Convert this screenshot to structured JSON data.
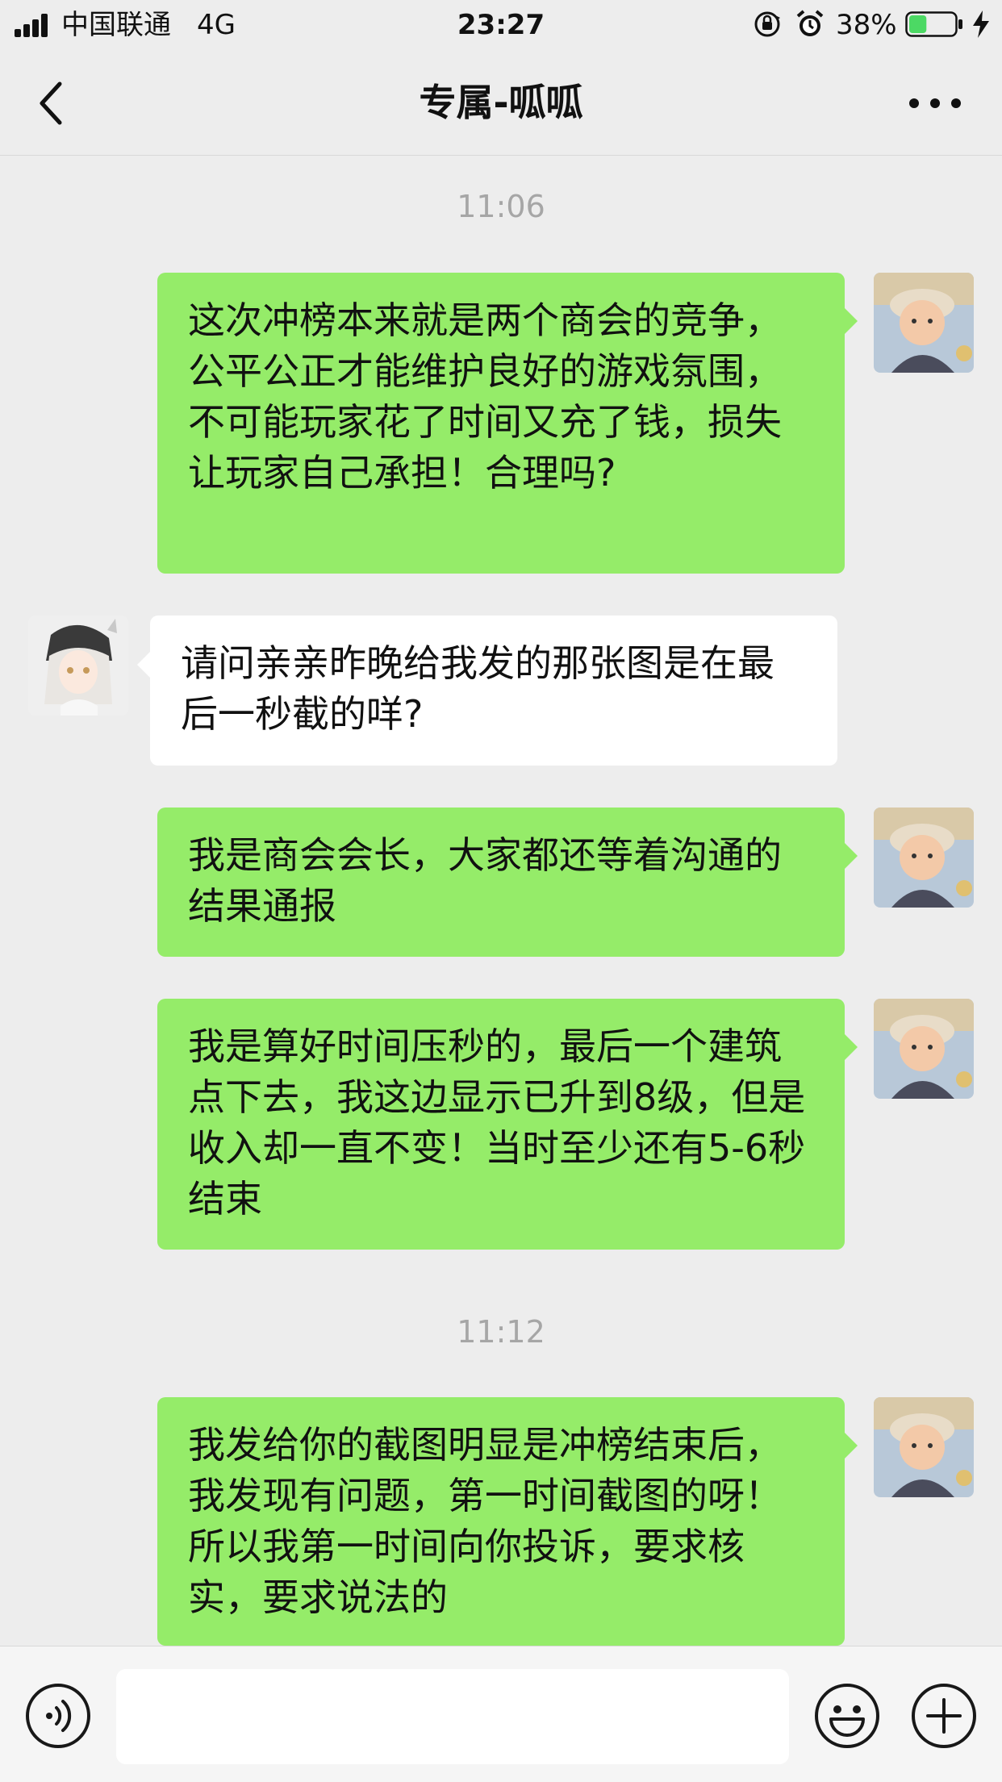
{
  "status_bar": {
    "carrier": "中国联通",
    "network": "4G",
    "time": "23:27",
    "battery_percent": "38%",
    "battery_level": 0.38,
    "battery_color": "#4cd964"
  },
  "header": {
    "title": "专属-呱呱",
    "back_icon": "chevron-left-icon",
    "more_icon": "more-dots-icon"
  },
  "chat": {
    "timestamps": [
      "11:06",
      "11:12"
    ],
    "messages": [
      {
        "side": "right",
        "text": "这次冲榜本来就是两个商会的竞争，公平公正才能维护良好的游戏氛围，不可能玩家花了时间又充了钱，损失让玩家自己承担！合理吗?"
      },
      {
        "side": "left",
        "text": "请问亲亲昨晚给我发的那张图是在最后一秒截的咩?"
      },
      {
        "side": "right",
        "text": "我是商会会长，大家都还等着沟通的结果通报"
      },
      {
        "side": "right",
        "text": "我是算好时间压秒的，最后一个建筑点下去，我这边显示已升到8级，但是收入却一直不变！当时至少还有5-6秒结束"
      },
      {
        "side": "right",
        "text": "我发给你的截图明显是冲榜结束后，我发现有问题，第一时间截图的呀！所以我第一时间向你投诉，要求核实，要求说法的"
      }
    ],
    "bubble_colors": {
      "sent": "#95ec69",
      "received": "#ffffff"
    }
  },
  "input_bar": {
    "value": "",
    "voice_icon": "voice-icon",
    "emoji_icon": "emoji-icon",
    "plus_icon": "plus-circle-icon"
  }
}
